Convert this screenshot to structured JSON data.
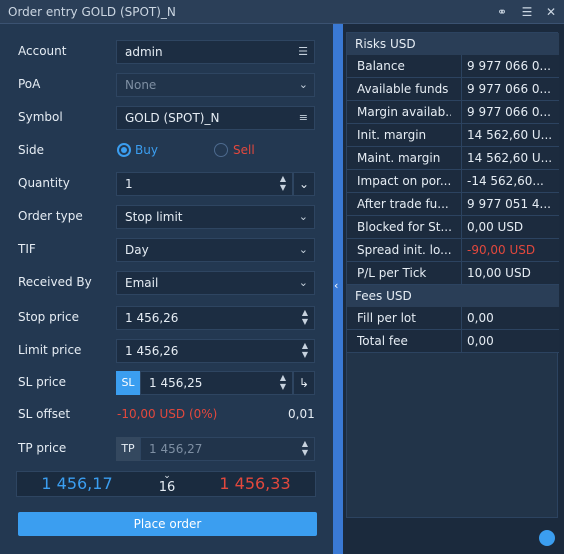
{
  "window": {
    "title": "Order entry GOLD (SPOT)_N"
  },
  "form": {
    "account": {
      "label": "Account",
      "value": "admin"
    },
    "poa": {
      "label": "PoA",
      "placeholder": "None"
    },
    "symbol": {
      "label": "Symbol",
      "value": "GOLD (SPOT)_N"
    },
    "side": {
      "label": "Side",
      "buy": "Buy",
      "sell": "Sell",
      "selected": "Buy"
    },
    "quantity": {
      "label": "Quantity",
      "value": "1"
    },
    "order_type": {
      "label": "Order type",
      "value": "Stop limit"
    },
    "tif": {
      "label": "TIF",
      "value": "Day"
    },
    "received_by": {
      "label": "Received By",
      "value": "Email"
    },
    "stop_price": {
      "label": "Stop price",
      "value": "1 456,26"
    },
    "limit_price": {
      "label": "Limit price",
      "value": "1 456,26"
    },
    "sl_price": {
      "label": "SL price",
      "tag": "SL",
      "value": "1 456,25"
    },
    "sl_offset": {
      "label": "SL offset",
      "value": "-10,00 USD (0%)",
      "right_value": "0,01"
    },
    "tp_price": {
      "label": "TP price",
      "tag": "TP",
      "placeholder": "1 456,27"
    }
  },
  "prices": {
    "bid": "1 456,17",
    "spread": "16",
    "ask": "1 456,33"
  },
  "place_order": {
    "label": "Place order"
  },
  "risks": {
    "header": "Risks USD",
    "rows": [
      {
        "label": "Balance",
        "value": "9 977 066 0..."
      },
      {
        "label": "Available funds",
        "value": "9 977 066 0..."
      },
      {
        "label": "Margin availab...",
        "value": "9 977 066 0..."
      },
      {
        "label": "Init. margin",
        "value": "14 562,60 U..."
      },
      {
        "label": "Maint. margin",
        "value": "14 562,60 U..."
      },
      {
        "label": "Impact on por...",
        "value": "-14 562,60..."
      },
      {
        "label": "After trade fu...",
        "value": "9 977 051 4..."
      },
      {
        "label": "Blocked for St...",
        "value": "0,00 USD"
      },
      {
        "label": "Spread init. lo...",
        "value": "-90,00 USD",
        "negative": true
      },
      {
        "label": "P/L per Tick",
        "value": "10,00 USD"
      }
    ]
  },
  "fees": {
    "header": "Fees USD",
    "rows": [
      {
        "label": "Fill per lot",
        "value": "0,00"
      },
      {
        "label": "Total fee",
        "value": "0,00"
      }
    ]
  },
  "colors": {
    "accent": "#3b9ef0",
    "negative": "#e2483d",
    "panel": "#233851"
  }
}
